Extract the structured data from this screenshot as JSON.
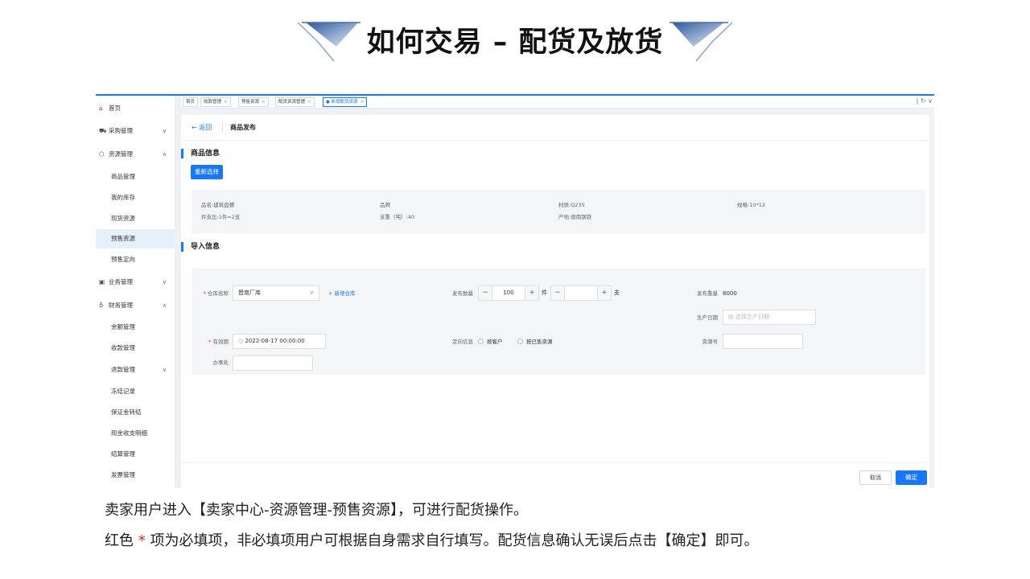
{
  "slide": {
    "title": "如何交易 – 配货及放货"
  },
  "sidebar": {
    "items": [
      {
        "label": "首页",
        "icon": "home-icon"
      },
      {
        "label": "采购管理",
        "icon": "truck-icon"
      },
      {
        "label": "资源管理",
        "icon": "cube-icon"
      },
      {
        "label": "商品管理"
      },
      {
        "label": "我的库存"
      },
      {
        "label": "现货资源"
      },
      {
        "label": "预售资源"
      },
      {
        "label": "预售定向"
      },
      {
        "label": "业务管理",
        "icon": "briefcase-icon"
      },
      {
        "label": "财务管理",
        "icon": "wallet-icon"
      },
      {
        "label": "余额管理"
      },
      {
        "label": "收款管理"
      },
      {
        "label": "退款管理"
      },
      {
        "label": "冻结记录"
      },
      {
        "label": "保证金转结"
      },
      {
        "label": "现金收支明细"
      },
      {
        "label": "结算管理"
      },
      {
        "label": "发票管理"
      }
    ]
  },
  "tabs": [
    {
      "label": "首页"
    },
    {
      "label": "收款管理"
    },
    {
      "label": "预售资源"
    },
    {
      "label": "配货资源管理"
    },
    {
      "label": "新增配货资源"
    }
  ],
  "page": {
    "back_label": "返回",
    "title": "商品发布"
  },
  "product_section": {
    "title": "商品信息",
    "reselect_button": "重新选择",
    "info": {
      "name": "品名:建筑盘螺",
      "brand": "品牌",
      "material": "材质:Q235",
      "spec": "规格:10*12",
      "ratio": "件支比:1件=2支",
      "weight": "支重（吨）:40",
      "origin": "产地:晋南钢铁"
    }
  },
  "import_section": {
    "title": "导入信息",
    "warehouse_label": "仓库名称",
    "warehouse_value": "晋南厂库",
    "add_warehouse": "+ 新增仓库",
    "qty_label": "发布数量",
    "qty_pieces_value": "100",
    "qty_pieces_unit": "件",
    "qty_sticks_value": "",
    "qty_sticks_unit": "支",
    "weight_label": "发布重量",
    "weight_value": "8000",
    "prod_date_label": "生产日期",
    "prod_date_placeholder": "选择生产日期",
    "validity_label": "有效期",
    "validity_value": "2022-08-17 00:00:00",
    "target_label": "定向信息",
    "target_opt1": "按客户",
    "target_opt2": "按已售资源",
    "resource_no_label": "资源号",
    "resource_no_value": "",
    "office_label": "办事处",
    "office_value": ""
  },
  "footer": {
    "cancel": "取消",
    "confirm": "确定"
  },
  "caption": {
    "line1": "卖家用户进入【卖家中心-资源管理-预售资源】，可进行配货操作。",
    "line2_prefix": "红色",
    "line2_star": "*",
    "line2_suffix": "项为必填项，非必填项用户可根据自身需求自行填写。配货信息确认无误后点击【确定】即可。"
  },
  "colors": {
    "primary": "#1677ff",
    "required": "#f5222d",
    "panel": "#f3f5f8"
  }
}
